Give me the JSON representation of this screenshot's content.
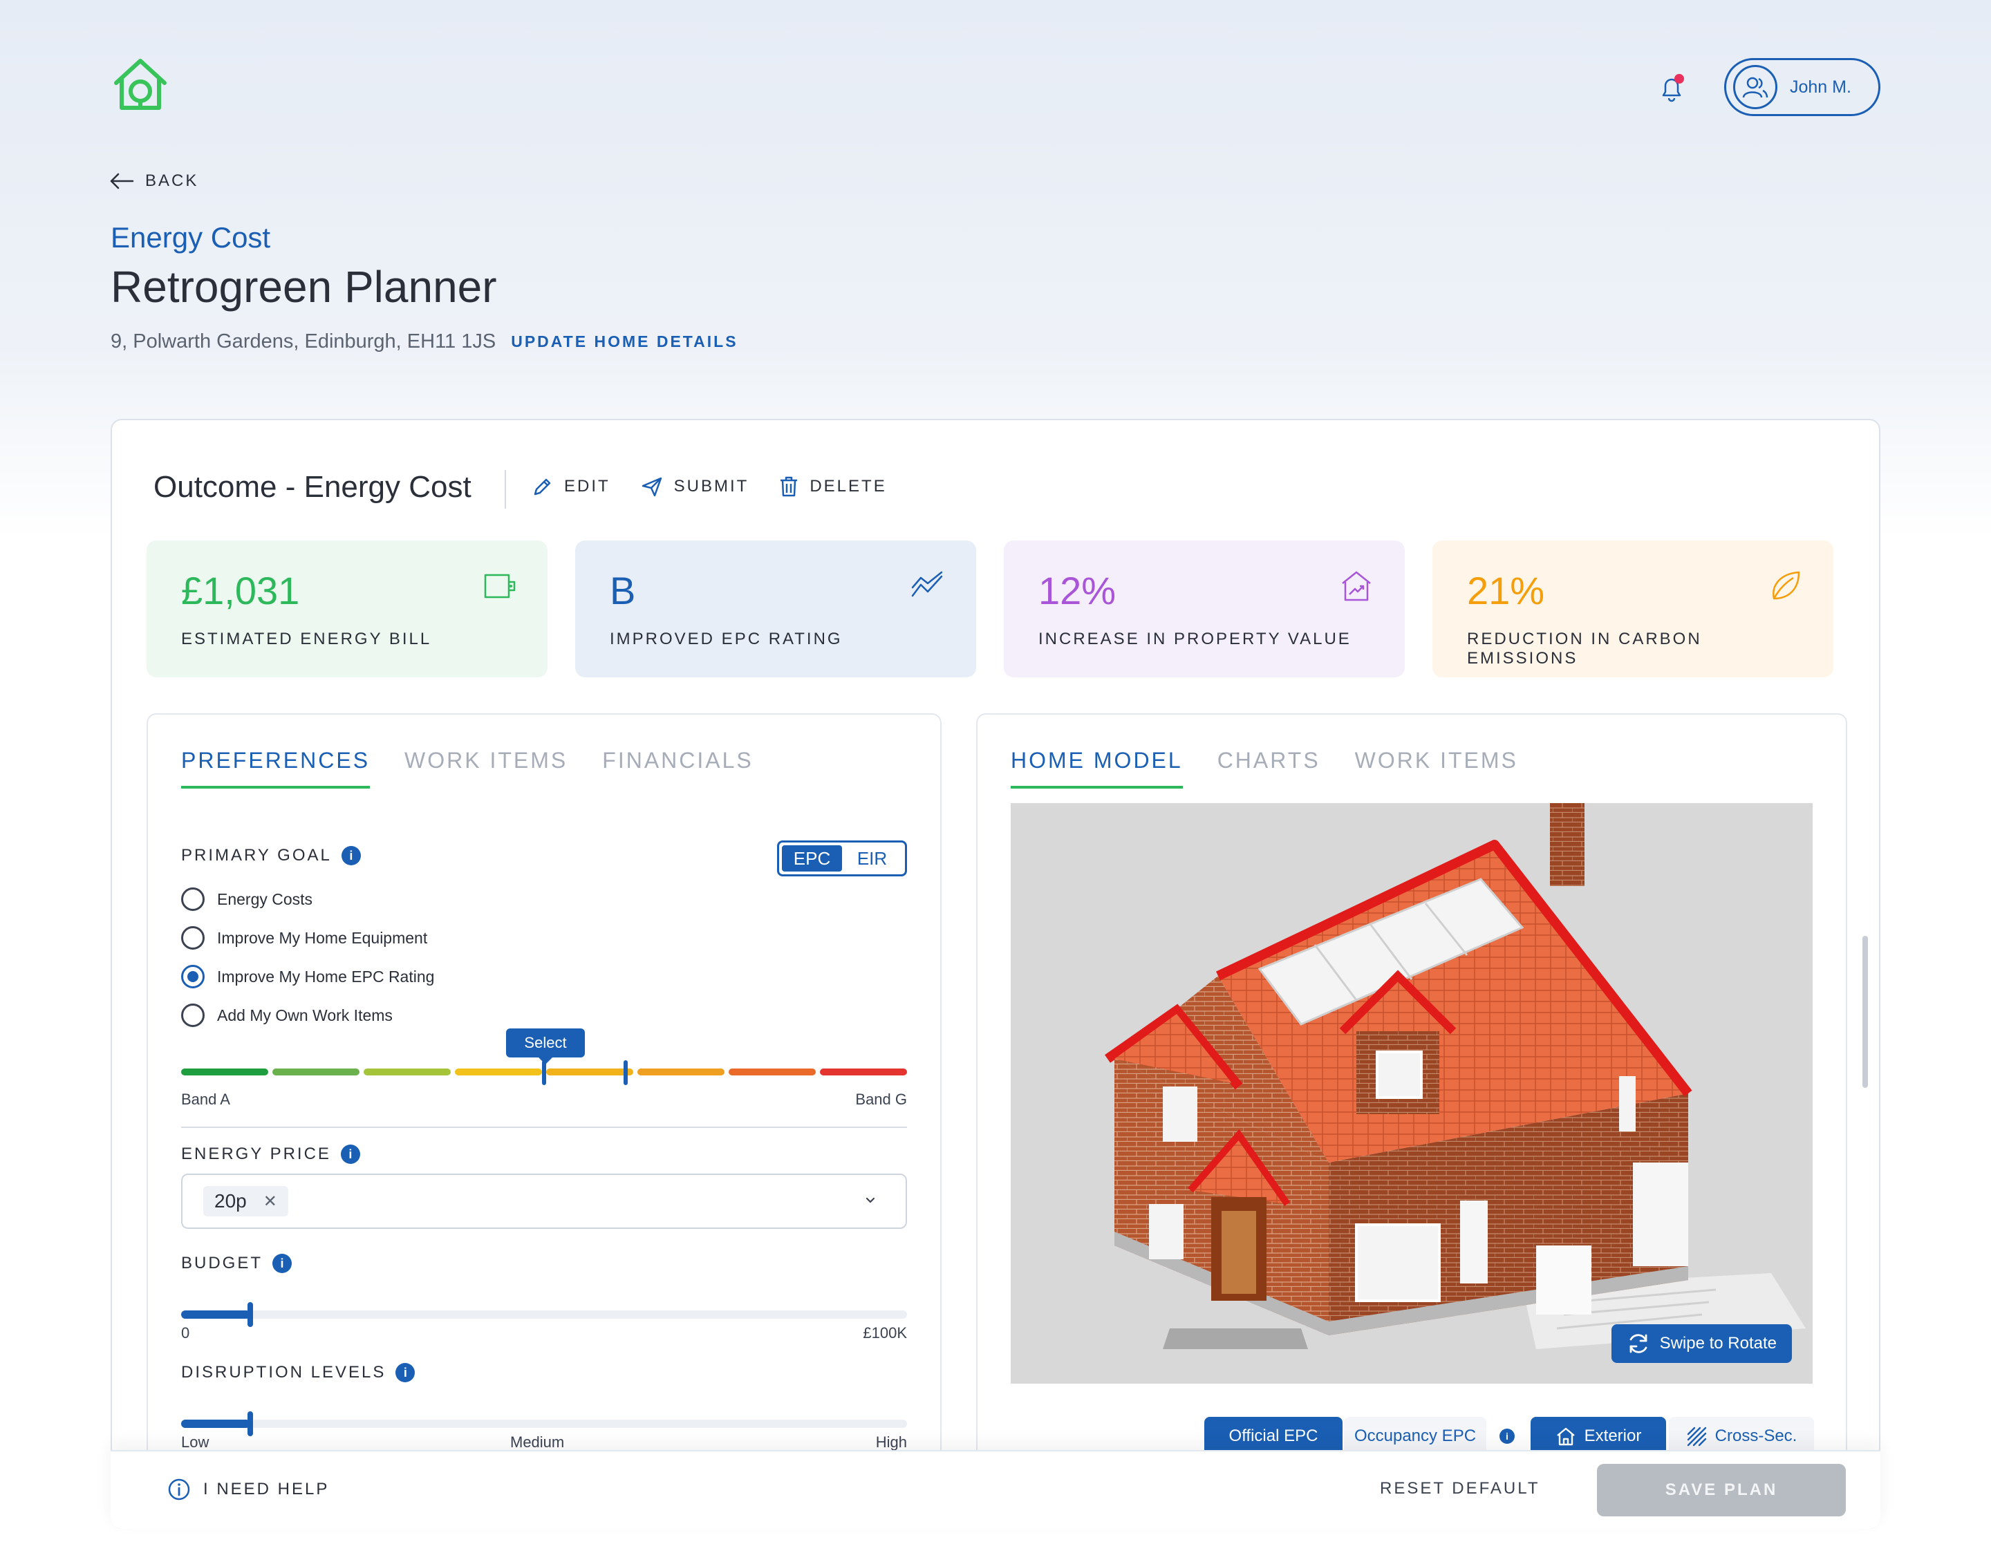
{
  "header": {
    "user_name": "John M.",
    "back_label": "BACK",
    "breadcrumb": "Energy Cost",
    "title": "Retrogreen Planner",
    "address": "9, Polwarth Gardens, Edinburgh, EH11 1JS",
    "update_link": "UPDATE HOME DETAILS"
  },
  "outcome": {
    "title": "Outcome - Energy Cost",
    "actions": {
      "edit": "EDIT",
      "submit": "SUBMIT",
      "delete": "DELETE"
    }
  },
  "stats": [
    {
      "value": "£1,031",
      "label": "ESTIMATED ENERGY BILL",
      "color": "#2eb85c",
      "bg": "#edf8f0",
      "icon": "wallet-icon"
    },
    {
      "value": "B",
      "label": "IMPROVED EPC RATING",
      "color": "#1a5fb4",
      "bg": "#e8eef7",
      "icon": "trend-chart-icon"
    },
    {
      "value": "12%",
      "label": "INCREASE IN PROPERTY VALUE",
      "color": "#a855d8",
      "bg": "#f5eefb",
      "icon": "house-growth-icon"
    },
    {
      "value": "21%",
      "label": "REDUCTION IN CARBON EMISSIONS",
      "color": "#f59e0b",
      "bg": "#fff5e8",
      "icon": "leaf-icon"
    }
  ],
  "left_panel": {
    "tabs": [
      "PREFERENCES",
      "WORK ITEMS",
      "FINANCIALS"
    ],
    "primary_goal_label": "PRIMARY GOAL",
    "toggle": [
      "EPC",
      "EIR"
    ],
    "goals": [
      "Energy Costs",
      "Improve My Home Equipment",
      "Improve My Home EPC Rating",
      "Add My Own Work Items"
    ],
    "selected_goal_index": 2,
    "band_tooltip": "Select",
    "band_start": "Band A",
    "band_end": "Band G",
    "band_colors": [
      "#1e9e3e",
      "#6ab04c",
      "#a6c43a",
      "#f2c21b",
      "#f2b21b",
      "#f0a020",
      "#ea6a2a",
      "#e3342f"
    ],
    "energy_price_label": "ENERGY PRICE",
    "energy_price_chip": "20p",
    "budget_label": "BUDGET",
    "budget_min": "0",
    "budget_max": "£100K",
    "budget_value_fraction": 0.095,
    "disruption_label": "DISRUPTION LEVELS",
    "disruption_low": "Low",
    "disruption_medium": "Medium",
    "disruption_high": "High",
    "disruption_value_fraction": 0.095
  },
  "right_panel": {
    "tabs": [
      "HOME MODEL",
      "CHARTS",
      "WORK ITEMS"
    ],
    "rotate_label": "Swipe to Rotate",
    "epc_options": [
      "Official EPC",
      "Occupancy EPC"
    ],
    "view_options": [
      "Exterior",
      "Cross-Sec."
    ]
  },
  "footer": {
    "help": "I NEED HELP",
    "reset": "RESET DEFAULT",
    "save": "SAVE PLAN"
  }
}
